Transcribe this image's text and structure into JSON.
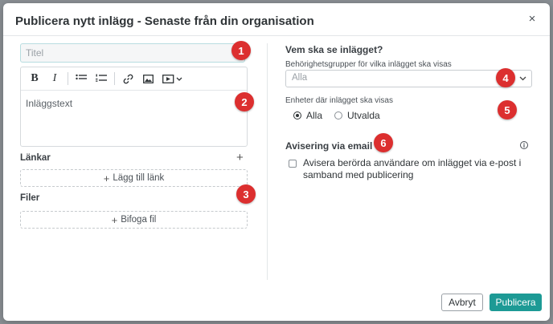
{
  "dialog": {
    "title": "Publicera nytt inlägg - Senaste från din organisation",
    "close_label": "×"
  },
  "left": {
    "title_placeholder": "Titel",
    "body_placeholder": "Inläggstext",
    "toolbar": [
      "bold",
      "italic",
      "bullet-list",
      "numbered-list",
      "link",
      "image",
      "video"
    ],
    "links_label": "Länkar",
    "add_link_label": "Lägg till länk",
    "files_label": "Filer",
    "attach_file_label": "Bifoga fil"
  },
  "right": {
    "audience_heading": "Vem ska se inlägget?",
    "groups_label": "Behörighetsgrupper för vilka inlägget ska visas",
    "groups_selected": "Alla",
    "units_label": "Enheter där inlägget ska visas",
    "units_options": [
      {
        "label": "Alla",
        "checked": true
      },
      {
        "label": "Utvalda",
        "checked": false
      }
    ],
    "email_heading": "Avisering via email",
    "email_checkbox_label": "Avisera berörda användare om inlägget via e-post i samband med publicering",
    "email_checked": false
  },
  "footer": {
    "cancel_label": "Avbryt",
    "publish_label": "Publicera"
  },
  "markers": [
    "1",
    "2",
    "3",
    "4",
    "5",
    "6"
  ],
  "colors": {
    "accent": "#1d9a95",
    "marker": "#dc2f2f"
  }
}
